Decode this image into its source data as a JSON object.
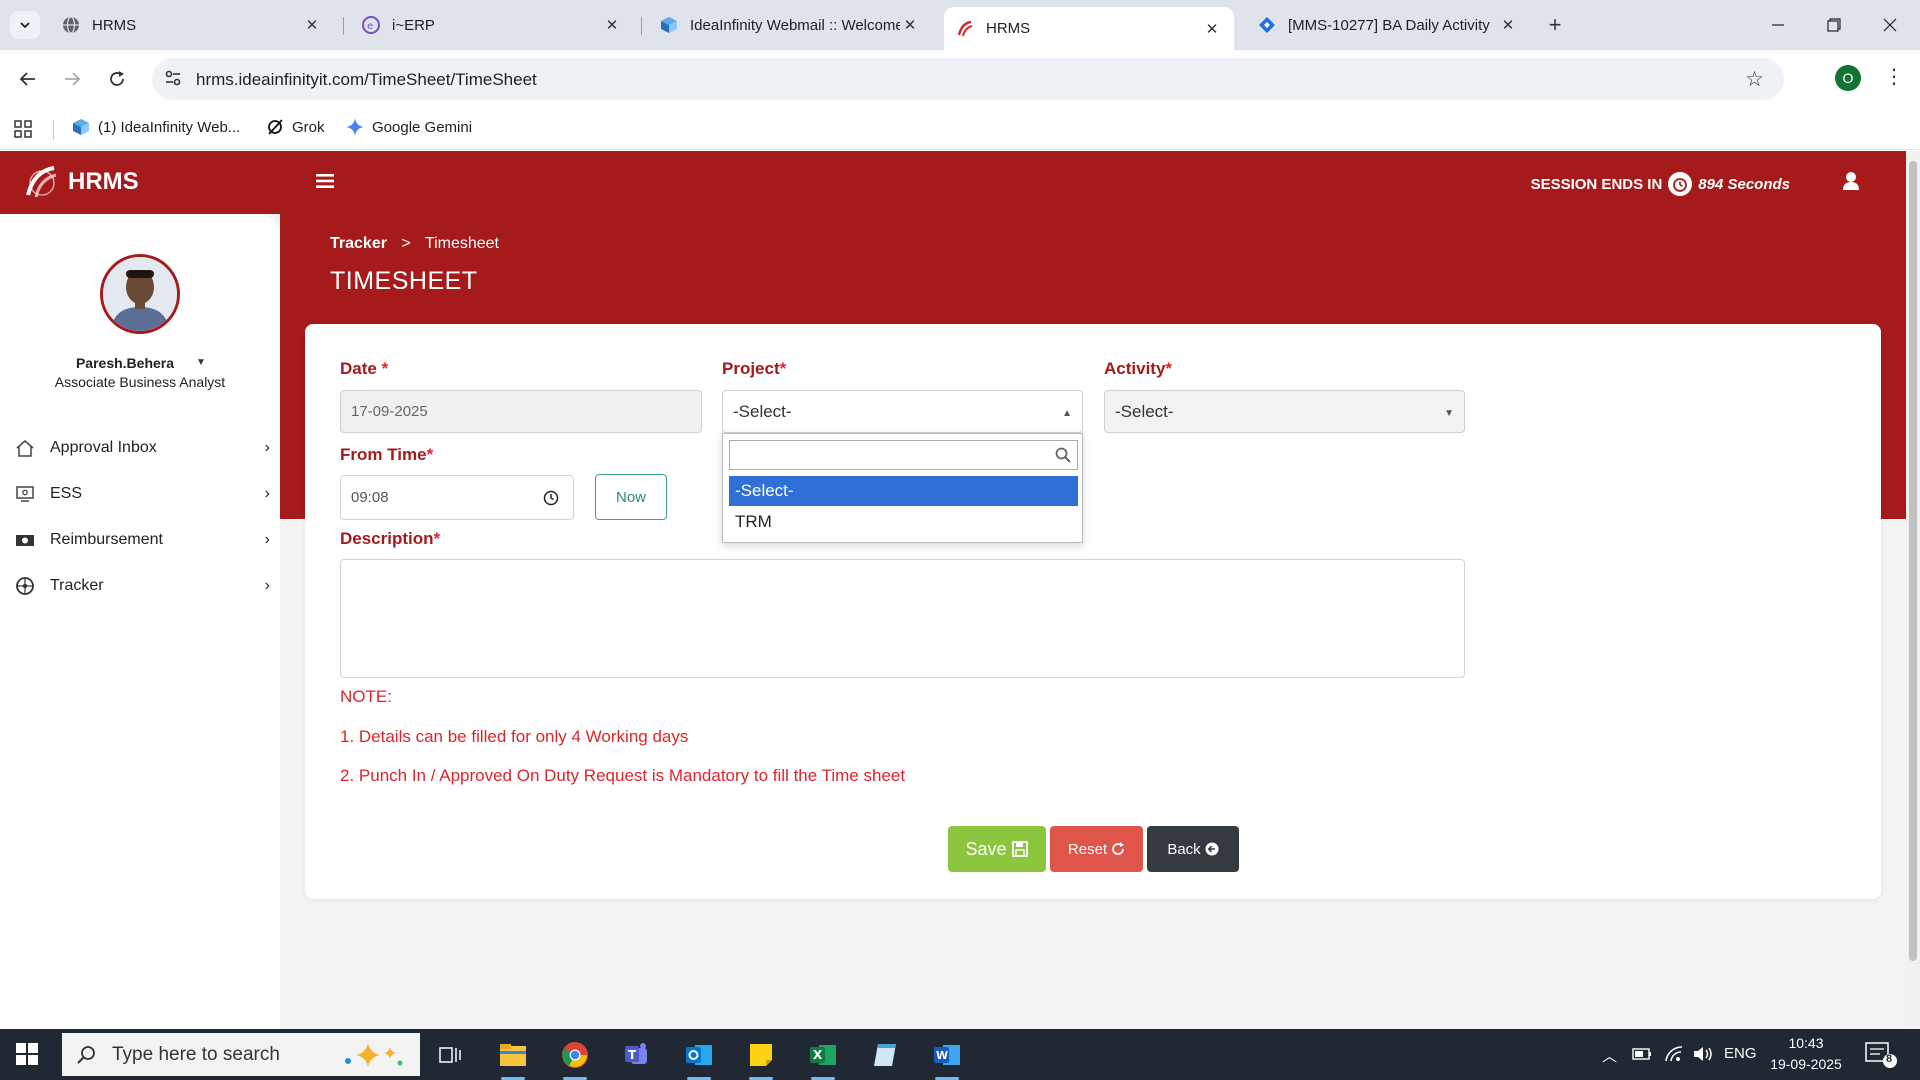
{
  "browser": {
    "tabs": [
      {
        "title": "HRMS",
        "active": false
      },
      {
        "title": "i~ERP",
        "active": false
      },
      {
        "title": "IdeaInfinity Webmail :: Welcome",
        "active": false
      },
      {
        "title": "HRMS",
        "active": true
      },
      {
        "title": "[MMS-10277] BA Daily Activity",
        "active": false
      }
    ],
    "url": "hrms.ideainfinityit.com/TimeSheet/TimeSheet",
    "profile_initial": "O",
    "bookmarks": [
      {
        "label": "(1) IdeaInfinity Web..."
      },
      {
        "label": "Grok"
      },
      {
        "label": "Google Gemini"
      }
    ]
  },
  "app": {
    "brand": "HRMS",
    "session": {
      "prefix": "SESSION ENDS IN",
      "value": "894 Seconds"
    },
    "user": {
      "name": "Paresh.Behera",
      "role": "Associate Business Analyst"
    },
    "menu": [
      {
        "label": "Approval Inbox",
        "icon": "home-icon"
      },
      {
        "label": "ESS",
        "icon": "monitor-icon"
      },
      {
        "label": "Reimbursement",
        "icon": "money-icon"
      },
      {
        "label": "Tracker",
        "icon": "dial-icon"
      }
    ],
    "breadcrumb": {
      "parent": "Tracker",
      "separator": ">",
      "current": "Timesheet"
    },
    "page_title": "TIMESHEET",
    "form": {
      "date_label": "Date",
      "date_value": "17-09-2025",
      "project_label": "Project",
      "project_value": "-Select-",
      "activity_label": "Activity",
      "activity_value": "-Select-",
      "from_time_label": "From Time",
      "from_time_value": "09:08",
      "now_label": "Now",
      "description_label": "Description",
      "required_mark": "*",
      "project_options": [
        "-Select-",
        "TRM"
      ]
    },
    "notes": {
      "heading": "NOTE:",
      "items": [
        "1. Details can be filled for only 4 Working days",
        "2. Punch In / Approved On Duty Request is Mandatory to fill the Time sheet"
      ]
    },
    "buttons": {
      "save": "Save",
      "reset": "Reset",
      "back": "Back"
    },
    "colors": {
      "primary": "#a51a1a",
      "save": "#8cc63f",
      "reset": "#e0554a",
      "back": "#343a40",
      "selected": "#2f6fd6"
    }
  },
  "taskbar": {
    "search_placeholder": "Type here to search",
    "language": "ENG",
    "time": "10:43",
    "date": "19-09-2025",
    "notifications": "8"
  }
}
